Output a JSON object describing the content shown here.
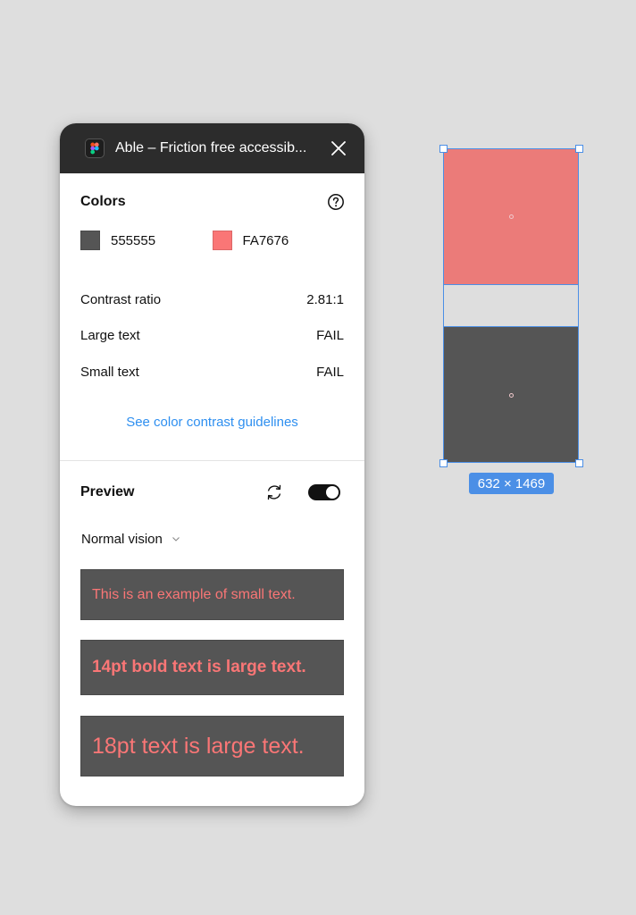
{
  "window": {
    "title": "Able – Friction free accessib...",
    "close_icon": "close-icon",
    "app_icon": "figma-logo-icon"
  },
  "colors": {
    "title": "Colors",
    "help_icon": "help-icon",
    "foreground": {
      "label": "555555",
      "hex": "#555555"
    },
    "background": {
      "label": "FA7676",
      "hex": "#FA7676"
    }
  },
  "stats": [
    {
      "label": "Contrast ratio",
      "value": "2.81:1"
    },
    {
      "label": "Large text",
      "value": "FAIL"
    },
    {
      "label": "Small text",
      "value": "FAIL"
    }
  ],
  "guidelines_link": "See color contrast guidelines",
  "preview": {
    "title": "Preview",
    "swap_icon": "swap-refresh-icon",
    "toggle_on": true,
    "vision_mode": "Normal vision",
    "samples": [
      "This is an example of small text.",
      "14pt bold text is large text.",
      "18pt text is large text."
    ]
  },
  "canvas": {
    "selection_size": "632 × 1469",
    "top_fill": "#EB7B79",
    "bottom_fill": "#555555",
    "accent": "#4B8FE6"
  }
}
